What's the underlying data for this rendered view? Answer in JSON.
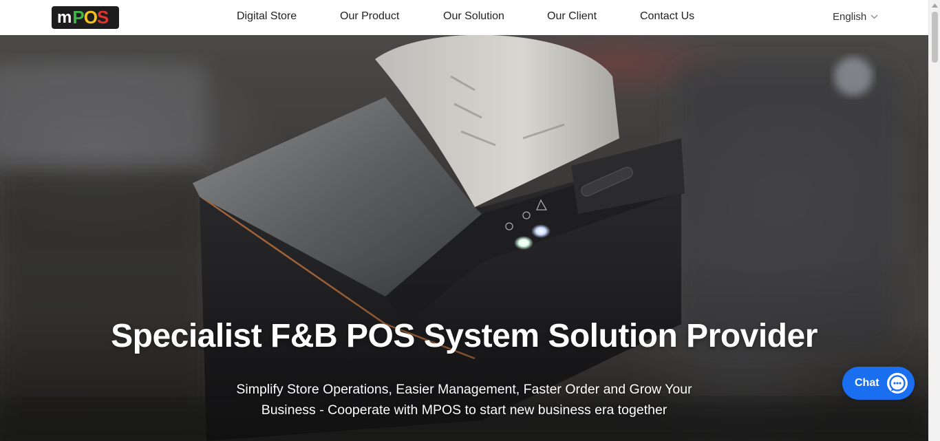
{
  "brand": {
    "logo_text": "POS",
    "logo_colors": [
      "#3db54a",
      "#f4c21b",
      "#e5322d"
    ]
  },
  "nav": {
    "items": [
      {
        "label": "Digital Store"
      },
      {
        "label": "Our Product"
      },
      {
        "label": "Our Solution"
      },
      {
        "label": "Our Client"
      },
      {
        "label": "Contact Us"
      }
    ],
    "language": "English",
    "language_icon": "chevron-down-icon"
  },
  "hero": {
    "title": "Specialist F&B POS System Solution Provider",
    "subtitle_line1": "Simplify Store Operations, Easier Management, Faster Order and Grow Your",
    "subtitle_line2": "Business - Cooperate with MPOS to start new business era together",
    "image": "receipt-printer-photo"
  },
  "chat": {
    "label": "Chat",
    "icon": "chat-bubble-icon",
    "color": "#1a6ff0"
  }
}
